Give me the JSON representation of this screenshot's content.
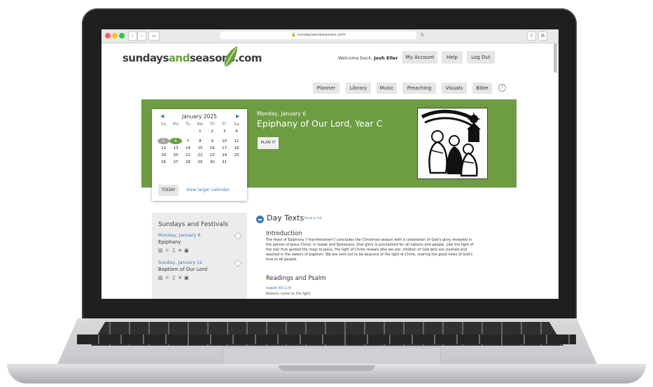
{
  "browser": {
    "url": "sundaysandseasons.com",
    "traffic_colors": [
      "#ff5f57",
      "#febc2e",
      "#28c840"
    ]
  },
  "header": {
    "logo_part1": "sundays",
    "logo_part2": "and",
    "logo_part3": "seasons.com",
    "welcome_prefix": "Welcome back,",
    "user_name": "Josh Eller",
    "my_account": "My Account",
    "help": "Help",
    "log_out": "Log Out"
  },
  "nav": {
    "items": [
      "Planner",
      "Library",
      "Music",
      "Preaching",
      "Visuals",
      "Bible"
    ],
    "help_icon": "?"
  },
  "calendar": {
    "month": "January 2025",
    "days_of_week": [
      "Su",
      "Mo",
      "Tu",
      "We",
      "Th",
      "Fr",
      "Sa"
    ],
    "weeks": [
      [
        "",
        "",
        "",
        "1",
        "2",
        "3",
        "4"
      ],
      [
        "5",
        "6",
        "7",
        "8",
        "9",
        "10",
        "11"
      ],
      [
        "12",
        "13",
        "14",
        "15",
        "16",
        "17",
        "18"
      ],
      [
        "19",
        "20",
        "21",
        "22",
        "23",
        "24",
        "25"
      ],
      [
        "26",
        "27",
        "28",
        "29",
        "30",
        "31",
        ""
      ]
    ],
    "today_button": "TODAY",
    "view_larger": "View larger calendar"
  },
  "hero": {
    "date": "Monday, January 6",
    "title": "Epiphany of Our Lord, Year C",
    "plan_button": "PLAN IT",
    "bg_color": "#6d9c42"
  },
  "sidebar": {
    "title": "Sundays and Festivals",
    "entries": [
      {
        "date": "Monday, January 6",
        "name": "Epiphany"
      },
      {
        "date": "Sunday, January 12",
        "name": "Baptism of Our Lord"
      }
    ]
  },
  "content": {
    "section_title": "Day Texts",
    "read_in_full": "Read in full",
    "intro_heading": "Introduction",
    "intro_text": "The feast of Epiphany (\"manifestation\") concludes the Christmas season with a celebration of God's glory revealed in the person of Jesus Christ. In Isaiah and Ephesians, that glory is proclaimed for all nations and people. Like the light of the star that guided the magi to Jesus, the light of Christ reveals who we are: children of God who are claimed and washed in the waters of baptism. We are sent out to be beacons of the light of Christ, sharing the good news of God's love to all people.",
    "readings_heading": "Readings and Psalm",
    "reading1_ref": "Isaiah 60:1-6",
    "reading1_sub": "Nations come to the light"
  }
}
